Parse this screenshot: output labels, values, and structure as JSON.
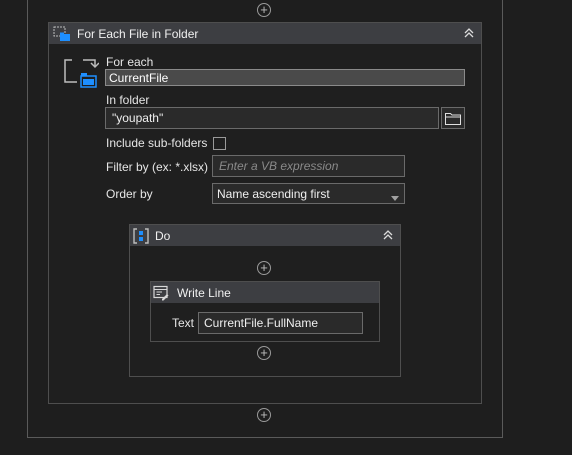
{
  "foreach_activity": {
    "title": "For Each File in Folder",
    "for_each_label": "For each",
    "for_each_value": "CurrentFile",
    "in_folder_label": "In folder",
    "in_folder_value": "\"youpath\"",
    "include_subfolders_label": "Include sub-folders",
    "include_subfolders_checked": false,
    "filter_label": "Filter by (ex: *.xlsx)",
    "filter_placeholder": "Enter a VB expression",
    "order_label": "Order by",
    "order_value": "Name ascending first"
  },
  "do_activity": {
    "title": "Do"
  },
  "write_line_activity": {
    "title": "Write Line",
    "text_label": "Text",
    "text_value": "CurrentFile.FullName"
  },
  "colors": {
    "background": "#1e1e1e",
    "header": "#3d3e42",
    "icon_blue": "#1e8fff"
  }
}
